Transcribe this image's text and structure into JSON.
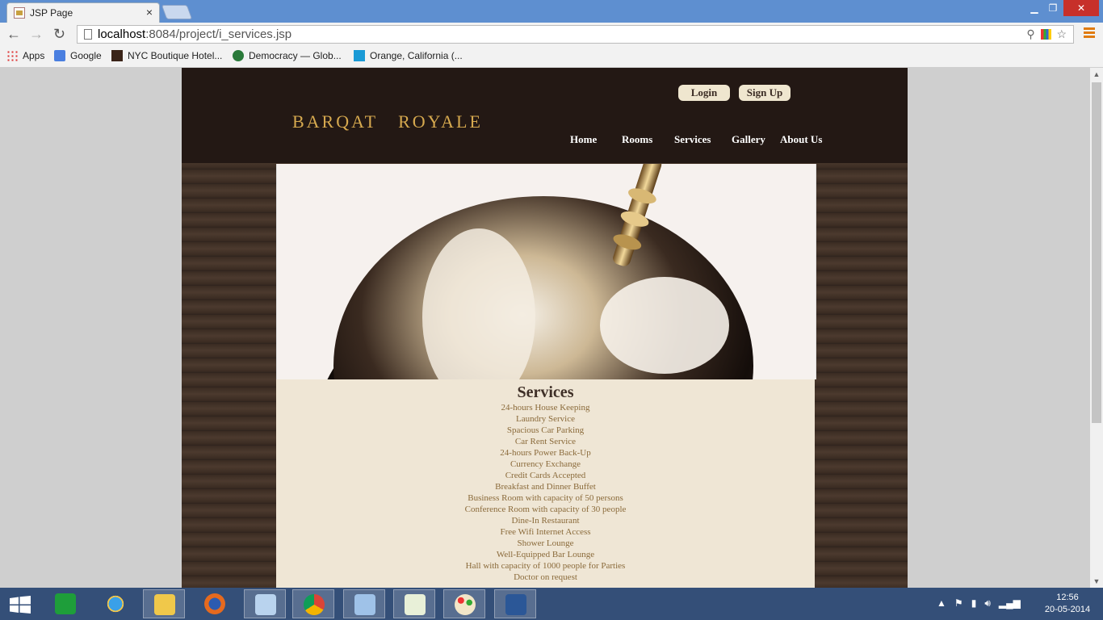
{
  "browser": {
    "tab_title": "JSP Page",
    "tab_close": "×",
    "url_host": "localhost",
    "url_rest": ":8084/project/i_services.jsp",
    "bookmarks": [
      {
        "label": "Apps",
        "icon": "apps-grid-icon"
      },
      {
        "label": "Google",
        "icon": "google-icon"
      },
      {
        "label": "NYC Boutique Hotel...",
        "icon": "hc-icon"
      },
      {
        "label": "Democracy — Glob...",
        "icon": "globe-icon"
      },
      {
        "label": "Orange, California (...",
        "icon": "f-icon"
      }
    ]
  },
  "site": {
    "logo": "BARQAT   ROYALE",
    "login": "Login",
    "signup": "Sign Up",
    "nav": [
      "Home",
      "Rooms",
      "Services",
      "Gallery",
      "About Us"
    ]
  },
  "services": {
    "title": "Services",
    "items": [
      "24-hours House Keeping",
      "Laundry Service",
      "Spacious Car Parking",
      "Car Rent Service",
      "24-hours Power Back-Up",
      "Currency Exchange",
      "Credit Cards Accepted",
      "Breakfast and Dinner Buffet",
      "Business Room with capacity of 50 persons",
      "Conference Room with capacity of 30 people",
      "Dine-In Restaurant",
      "Free Wifi Internet Access",
      "Shower Lounge",
      "Well-Equipped Bar Lounge",
      "Hall with capacity of 1000 people for Parties",
      "Doctor on request"
    ]
  },
  "taskbar": {
    "time": "12:56",
    "date": "20-05-2014"
  },
  "colors": {
    "header": "#231814",
    "logo": "#d6a94f",
    "content_bg": "#efe6d5",
    "list_text": "#8a6a3a"
  }
}
